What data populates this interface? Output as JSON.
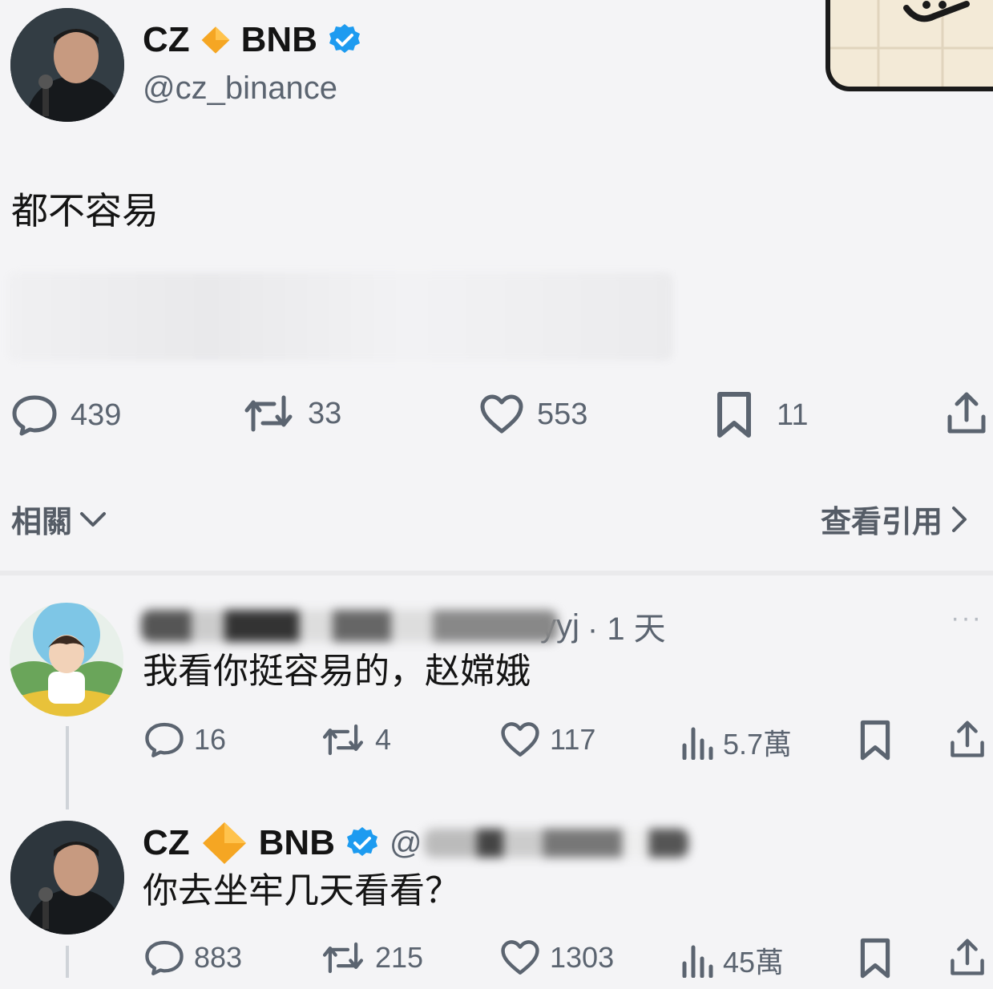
{
  "main_post": {
    "name_prefix": "CZ",
    "name_suffix": "BNB",
    "handle": "@cz_binance",
    "text": "都不容易",
    "stats": {
      "replies": "439",
      "reposts": "33",
      "likes": "553",
      "bookmarks": "11"
    }
  },
  "section": {
    "related_label": "相關",
    "view_quotes_label": "查看引用"
  },
  "reply1": {
    "handle_visible": "yyj",
    "time": "· 1 天",
    "more": "···",
    "text": "我看你挺容易的，赵嫦娥",
    "stats": {
      "replies": "16",
      "reposts": "4",
      "likes": "117",
      "views": "5.7萬"
    }
  },
  "reply2": {
    "name_prefix": "CZ",
    "name_suffix": "BNB",
    "handle_visible": "@",
    "text": "你去坐牢几天看看？",
    "stats": {
      "replies": "883",
      "reposts": "215",
      "likes": "1303",
      "views": "45萬"
    }
  },
  "colors": {
    "verified": "#1d9bf0",
    "diamond": "#f5a623",
    "muted": "#5b6470"
  }
}
